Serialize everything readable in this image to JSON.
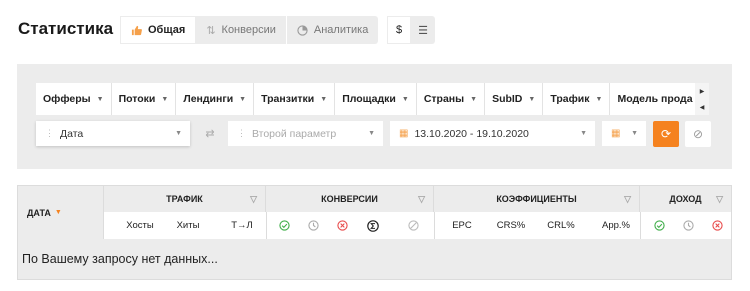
{
  "header": {
    "title": "Статистика",
    "tabs": [
      {
        "label": "Общая",
        "icon": "thumbs-up-icon",
        "active": true
      },
      {
        "label": "Конверсии",
        "icon": "sort-arrows-icon",
        "active": false
      },
      {
        "label": "Аналитика",
        "icon": "pie-chart-icon",
        "active": false
      }
    ],
    "currency": [
      {
        "label": "$",
        "active": true
      },
      {
        "label": "☰",
        "active": false
      }
    ]
  },
  "filters": {
    "group_by": [
      "Офферы",
      "Потоки",
      "Лендинги",
      "Транзитки",
      "Площадки",
      "Страны",
      "SubID",
      "Трафик",
      "Модель прода"
    ],
    "first_param": "Дата",
    "second_param_placeholder": "Второй параметр",
    "date_range": "13.10.2020 - 19.10.2020"
  },
  "table": {
    "date_header": "ДАТА",
    "groups": [
      {
        "label": "ТРАФИК"
      },
      {
        "label": "КОНВЕРСИИ"
      },
      {
        "label": "КОЭФФИЦИЕНТЫ"
      },
      {
        "label": "ДОХОД"
      }
    ],
    "traffic_cols": [
      "Хосты",
      "Хиты",
      "Т→Л"
    ],
    "coef_cols": [
      "EPC",
      "CRS%",
      "CRL%",
      "App.%"
    ],
    "empty_message": "По Вашему запросу нет данных..."
  },
  "colors": {
    "accent": "#f5821f",
    "panel_bg": "#ececec",
    "ok": "#3fae49",
    "rejected": "#e84a4a"
  }
}
